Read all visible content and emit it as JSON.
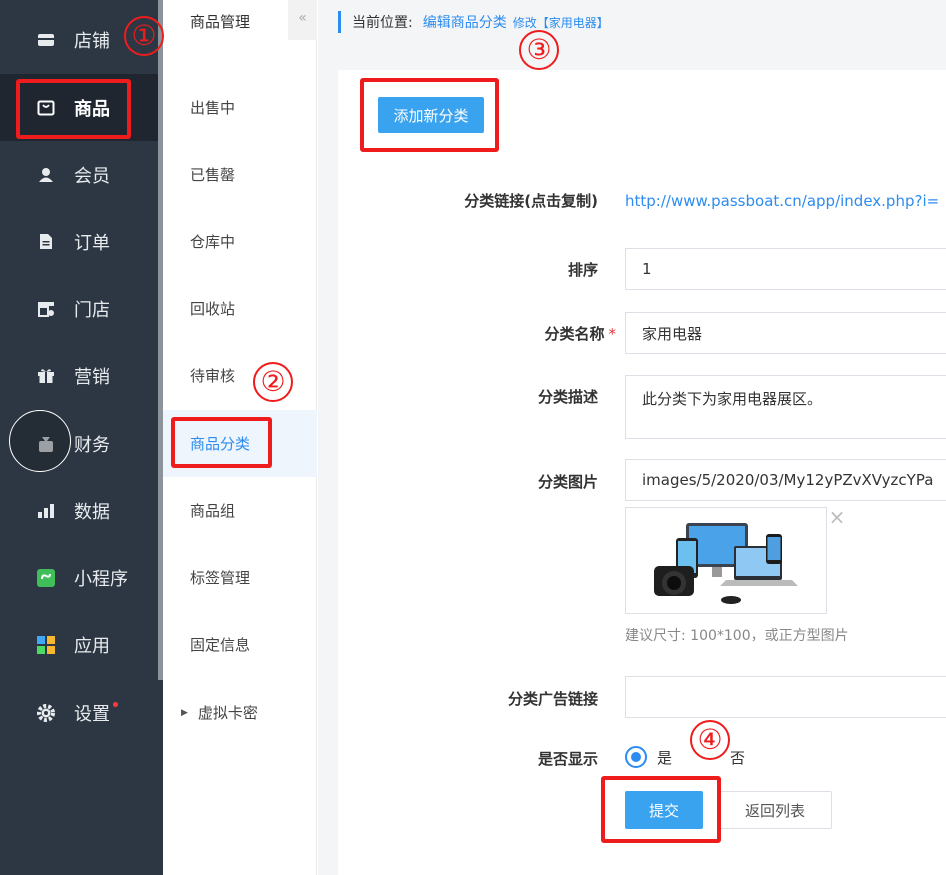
{
  "sidebar": {
    "items": [
      {
        "label": "店铺",
        "icon": "store-icon"
      },
      {
        "label": "商品",
        "icon": "bag-icon"
      },
      {
        "label": "会员",
        "icon": "user-icon"
      },
      {
        "label": "订单",
        "icon": "document-icon"
      },
      {
        "label": "门店",
        "icon": "shop-icon"
      },
      {
        "label": "营销",
        "icon": "gift-icon"
      },
      {
        "label": "财务",
        "icon": "finance-icon"
      },
      {
        "label": "数据",
        "icon": "bar-chart-icon"
      },
      {
        "label": "小程序",
        "icon": "mini-program-icon"
      },
      {
        "label": "应用",
        "icon": "apps-icon"
      },
      {
        "label": "设置",
        "icon": "gear-icon"
      }
    ]
  },
  "submenu": {
    "title": "商品管理",
    "collapse": "«",
    "items": [
      {
        "label": "出售中"
      },
      {
        "label": "已售罄"
      },
      {
        "label": "仓库中"
      },
      {
        "label": "回收站"
      },
      {
        "label": "待审核"
      },
      {
        "label": "商品分类"
      },
      {
        "label": "商品组"
      },
      {
        "label": "标签管理"
      },
      {
        "label": "固定信息"
      },
      {
        "label": "虚拟卡密"
      }
    ]
  },
  "breadcrumb": {
    "label": "当前位置:",
    "link": "编辑商品分类",
    "sub": "修改【家用电器】"
  },
  "form": {
    "add_button": "添加新分类",
    "link_label": "分类链接(点击复制)",
    "link_value": "http://www.passboat.cn/app/index.php?i=",
    "sort_label": "排序",
    "sort_value": "1",
    "name_label": "分类名称",
    "required_mark": "*",
    "name_value": "家用电器",
    "desc_label": "分类描述",
    "desc_value": "此分类下为家用电器展区。",
    "image_label": "分类图片",
    "image_value": "images/5/2020/03/My12yPZvXVyzcYPa",
    "image_remove": "×",
    "image_hint": "建议尺寸: 100*100，或正方型图片",
    "ad_label": "分类广告链接",
    "ad_value": "",
    "show_label": "是否显示",
    "show_yes": "是",
    "show_no": "否",
    "submit_button": "提交",
    "back_button": "返回列表"
  },
  "annotations": {
    "n1": "①",
    "n2": "②",
    "n3": "③",
    "n4": "④"
  },
  "colors": {
    "accent": "#2c8cf0",
    "sidebar_bg": "#2d3743",
    "annotation": "#ee1c1c"
  }
}
